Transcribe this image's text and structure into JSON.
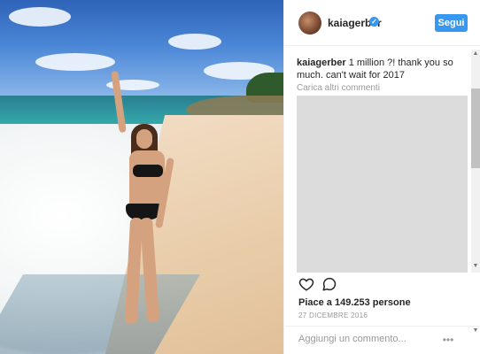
{
  "post": {
    "photo_alt": "beach photo"
  },
  "header": {
    "username": "kaiagerber",
    "verified_icon": "verified-badge-icon",
    "follow_label": "Segui"
  },
  "caption": {
    "username": "kaiagerber",
    "text": " 1 million ?! thank you so much. can't wait for 2017"
  },
  "comments": {
    "load_more": "Carica altri commenti"
  },
  "actions": {
    "like_icon": "heart-icon",
    "comment_icon": "comment-bubble-icon"
  },
  "likes": {
    "text": "Piace a 149.253 persone"
  },
  "date": "27 DICEMBRE 2016",
  "add_comment": {
    "placeholder": "Aggiungi un commento...",
    "options_icon": "ellipsis-icon"
  },
  "colors": {
    "accent": "#3897f0",
    "comments_placeholder_bg": "#dcdcdc"
  }
}
